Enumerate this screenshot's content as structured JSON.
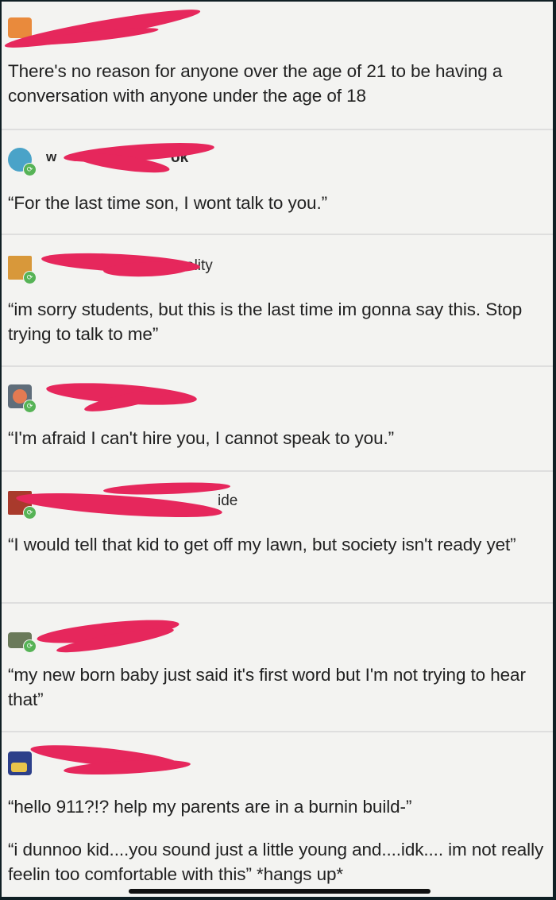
{
  "posts": [
    {
      "username": "",
      "text": "There's no reason for anyone over the age of 21 to be having a conversation with anyone under the age of 18"
    },
    {
      "username_start": "w",
      "username_end": "ok",
      "text": "“For the last time son, I wont talk to you.”"
    },
    {
      "username_end": "ality",
      "text": "“im sorry students, but this is the last time im gonna say this. Stop trying to talk to me”"
    },
    {
      "username": "",
      "text": "“I'm afraid I can't hire you, I cannot speak to you.”"
    },
    {
      "username_end": "ide",
      "text": "“I would tell that kid to get off my lawn, but society isn't ready yet”"
    },
    {
      "username": "",
      "text": "“my new born baby just said it's first word but I'm not trying to hear that”"
    },
    {
      "username": "",
      "text": "“hello 911?!? help my parents are in a burnin build-”"
    }
  ],
  "final_reply": "“i dunnoo kid....you sound just a little young and....idk.... im not really feelin too comfortable with this” *hangs up*",
  "colors": {
    "redaction": "#e6275c",
    "reblog": "#56b356",
    "background": "#f3f3f1"
  },
  "icons": [
    "reblog-icon"
  ]
}
